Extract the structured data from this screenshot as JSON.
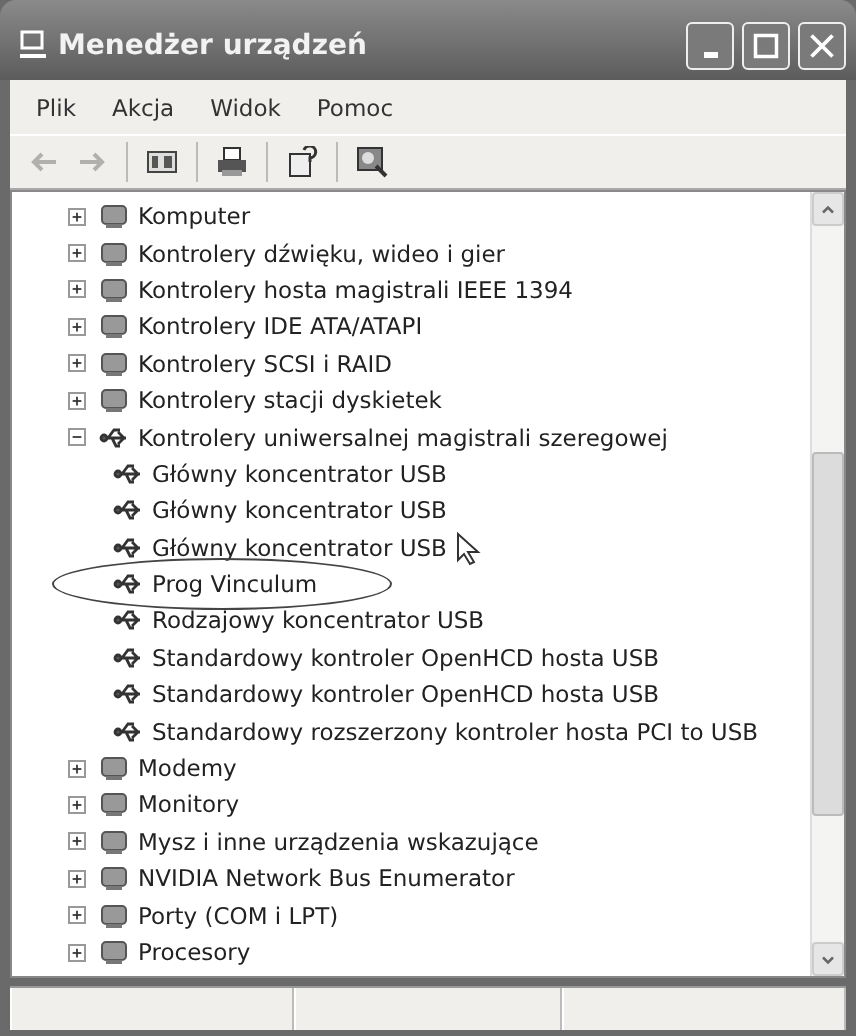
{
  "window": {
    "title": "Menedżer urządzeń"
  },
  "menu": [
    {
      "label": "Plik"
    },
    {
      "label": "Akcja"
    },
    {
      "label": "Widok"
    },
    {
      "label": "Pomoc"
    }
  ],
  "toolbar": [
    {
      "kind": "back",
      "disabled": true
    },
    {
      "kind": "forward",
      "disabled": true
    },
    {
      "kind": "separator"
    },
    {
      "kind": "tree"
    },
    {
      "kind": "separator"
    },
    {
      "kind": "print"
    },
    {
      "kind": "separator"
    },
    {
      "kind": "properties"
    },
    {
      "kind": "separator"
    },
    {
      "kind": "scan"
    }
  ],
  "tree": [
    {
      "label": "Komputer",
      "expanded": false
    },
    {
      "label": "Kontrolery dźwięku, wideo i gier",
      "expanded": false
    },
    {
      "label": "Kontrolery hosta magistrali IEEE 1394",
      "expanded": false
    },
    {
      "label": "Kontrolery IDE ATA/ATAPI",
      "expanded": false
    },
    {
      "label": "Kontrolery SCSI i RAID",
      "expanded": false
    },
    {
      "label": "Kontrolery stacji dyskietek",
      "expanded": false
    },
    {
      "label": "Kontrolery uniwersalnej magistrali szeregowej",
      "expanded": true,
      "children": [
        {
          "label": "Główny koncentrator USB",
          "circled": false
        },
        {
          "label": "Główny koncentrator USB",
          "circled": false
        },
        {
          "label": "Główny koncentrator USB",
          "circled": false
        },
        {
          "label": "Prog Vinculum",
          "circled": true
        },
        {
          "label": "Rodzajowy koncentrator USB",
          "circled": false
        },
        {
          "label": "Standardowy kontroler OpenHCD hosta USB",
          "circled": false
        },
        {
          "label": "Standardowy kontroler OpenHCD hosta USB",
          "circled": false
        },
        {
          "label": "Standardowy rozszerzony kontroler hosta PCI to USB",
          "circled": false
        }
      ]
    },
    {
      "label": "Modemy",
      "expanded": false
    },
    {
      "label": "Monitory",
      "expanded": false
    },
    {
      "label": "Mysz i inne urządzenia wskazujące",
      "expanded": false
    },
    {
      "label": "NVIDIA Network Bus Enumerator",
      "expanded": false
    },
    {
      "label": "Porty (COM i LPT)",
      "expanded": false
    },
    {
      "label": "Procesory",
      "expanded": false
    }
  ]
}
